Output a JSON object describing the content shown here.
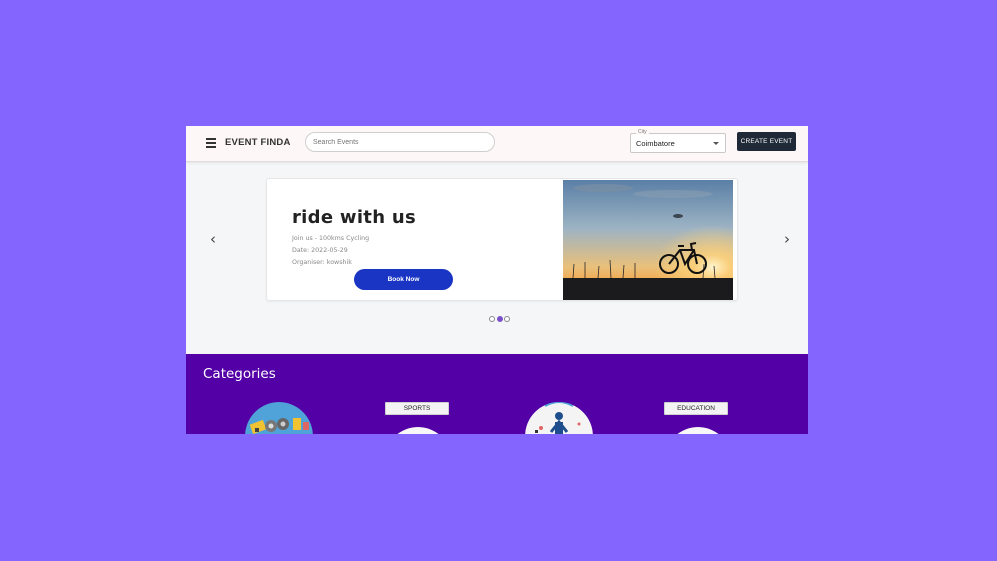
{
  "header": {
    "brand": "EVENT FINDA",
    "search_placeholder": "Search Events",
    "city_label": "City",
    "city_value": "Coimbatore",
    "create_label": "CREATE EVENT"
  },
  "carousel": {
    "prev_icon": "‹",
    "next_icon": "›",
    "slide": {
      "title": "ride with us",
      "line1": "Join us - 100kms Cycling",
      "line2": "Date: 2022-05-29",
      "line3": "Organiser: kowshik",
      "button": "Book Now"
    },
    "active_dot": 2
  },
  "categories": {
    "title": "Categories",
    "labels": [
      "SPORTS",
      "EDUCATION"
    ]
  },
  "colors": {
    "background": "#8465fd",
    "primary_button": "#1a35c4",
    "category_bg": "#5300a6",
    "create_button": "#1f2937"
  }
}
